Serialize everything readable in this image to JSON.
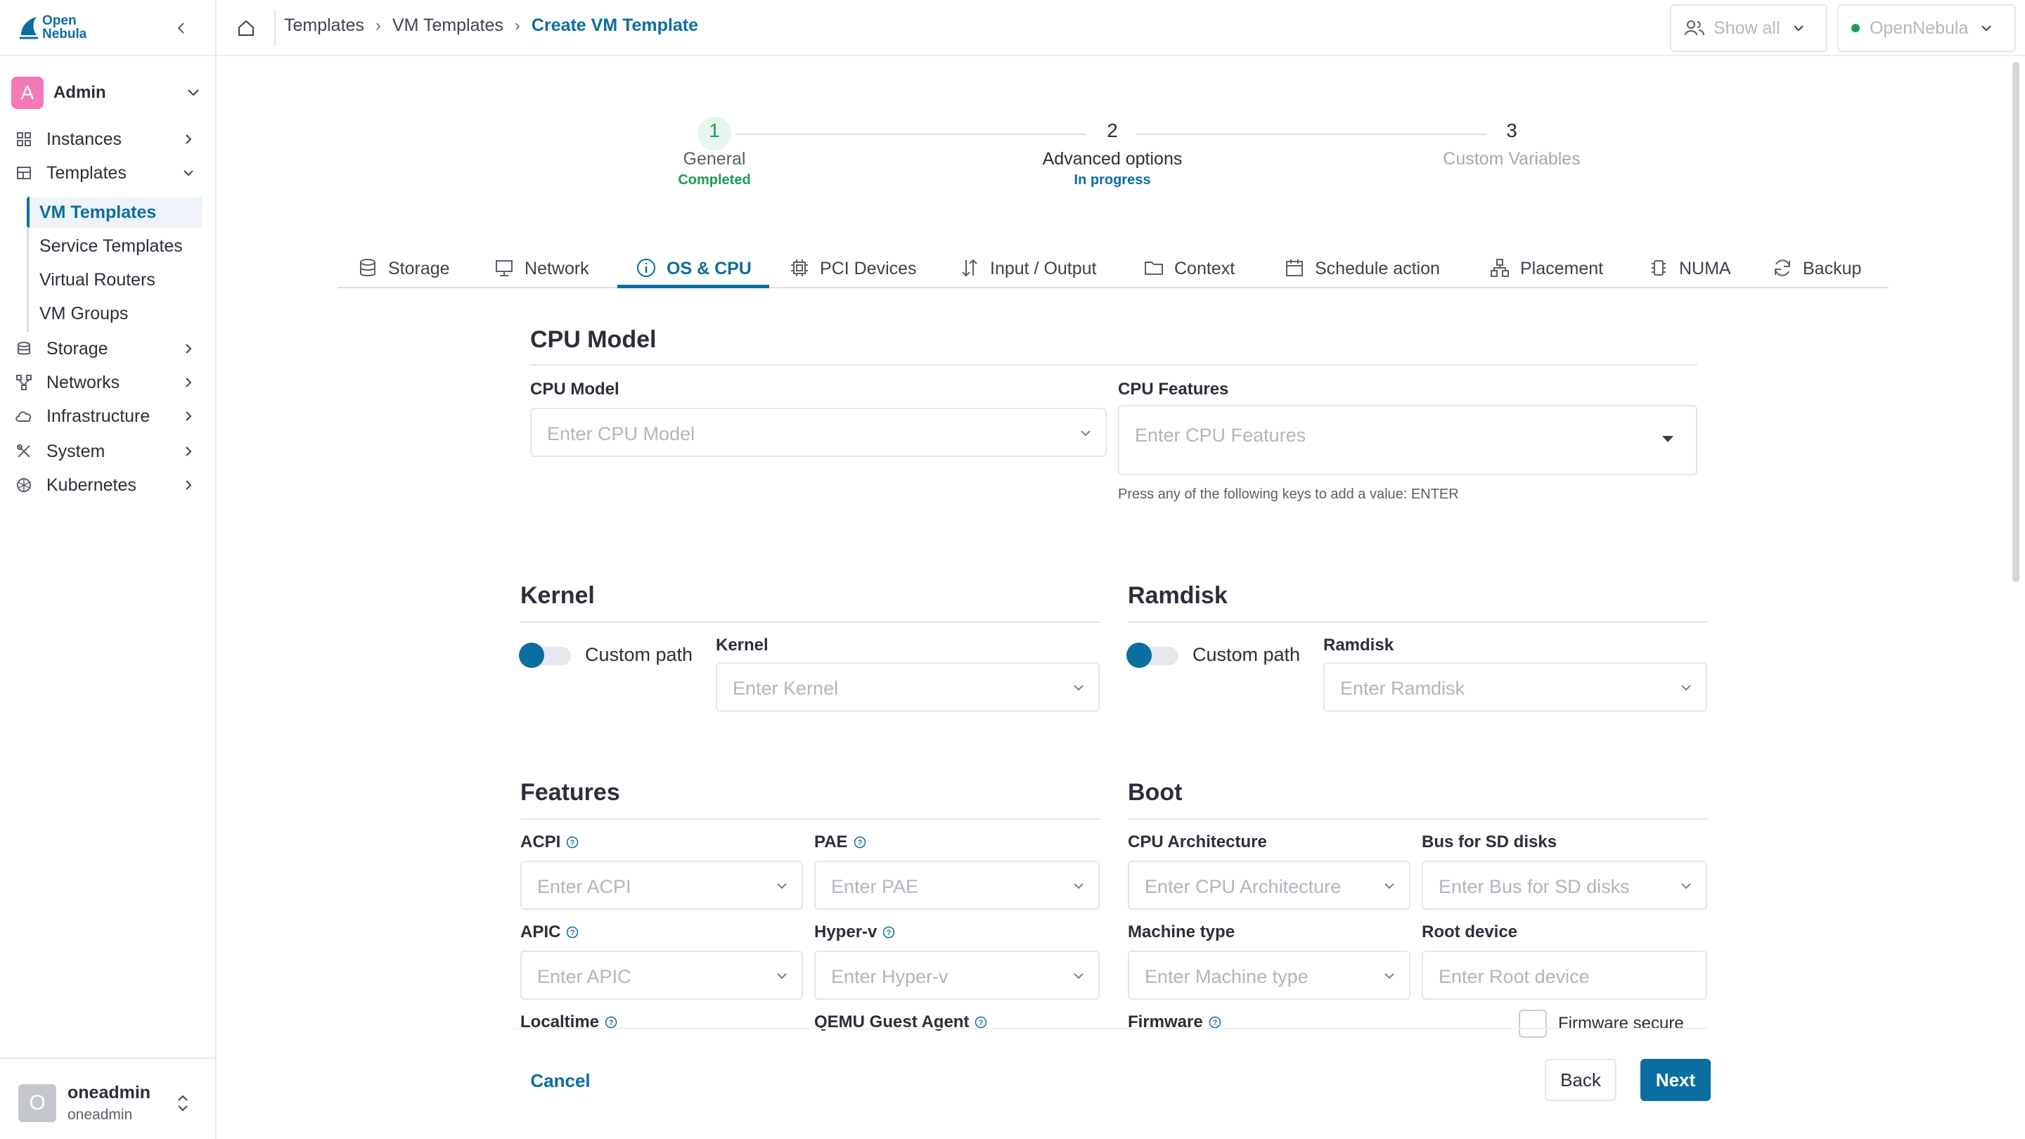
{
  "sidebar": {
    "logo_line1": "Open",
    "logo_line2": "Nebula",
    "account": {
      "initial": "A",
      "name": "Admin"
    },
    "items": [
      {
        "label": "Instances",
        "icon": "grid-icon"
      },
      {
        "label": "Templates",
        "icon": "templates-icon"
      },
      {
        "label": "Storage",
        "icon": "storage-icon"
      },
      {
        "label": "Networks",
        "icon": "network-icon"
      },
      {
        "label": "Infrastructure",
        "icon": "cloud-icon"
      },
      {
        "label": "System",
        "icon": "tools-icon"
      },
      {
        "label": "Kubernetes",
        "icon": "kubernetes-icon"
      }
    ],
    "templates_sub": [
      {
        "label": "VM Templates",
        "active": true
      },
      {
        "label": "Service Templates"
      },
      {
        "label": "Virtual Routers"
      },
      {
        "label": "VM Groups"
      }
    ],
    "user": {
      "initial": "O",
      "name": "oneadmin",
      "sub": "oneadmin"
    }
  },
  "header": {
    "breadcrumb": [
      "Templates",
      "VM Templates",
      "Create VM Template"
    ],
    "group_filter": "Show all",
    "zone_filter": "OpenNebula"
  },
  "stepper": [
    {
      "num": "1",
      "label": "General",
      "status": "Completed"
    },
    {
      "num": "2",
      "label": "Advanced options",
      "status": "In progress"
    },
    {
      "num": "3",
      "label": "Custom Variables",
      "status": ""
    }
  ],
  "tabs": [
    {
      "label": "Storage",
      "icon": "database-icon"
    },
    {
      "label": "Network",
      "icon": "monitor-icon"
    },
    {
      "label": "OS & CPU",
      "icon": "info-icon",
      "active": true
    },
    {
      "label": "PCI Devices",
      "icon": "chip-icon"
    },
    {
      "label": "Input / Output",
      "icon": "arrows-updown-icon"
    },
    {
      "label": "Context",
      "icon": "folder-icon"
    },
    {
      "label": "Schedule action",
      "icon": "calendar-icon"
    },
    {
      "label": "Placement",
      "icon": "placement-icon"
    },
    {
      "label": "NUMA",
      "icon": "numa-chip-icon"
    },
    {
      "label": "Backup",
      "icon": "refresh-icon"
    }
  ],
  "cpu_model": {
    "title": "CPU Model",
    "model_label": "CPU Model",
    "model_placeholder": "Enter CPU Model",
    "features_label": "CPU Features",
    "features_placeholder": "Enter CPU Features",
    "features_hint": "Press any of the following keys to add a value: ENTER"
  },
  "kernel": {
    "title": "Kernel",
    "toggle_label": "Custom path",
    "field_label": "Kernel",
    "placeholder": "Enter Kernel"
  },
  "ramdisk": {
    "title": "Ramdisk",
    "toggle_label": "Custom path",
    "field_label": "Ramdisk",
    "placeholder": "Enter Ramdisk"
  },
  "features": {
    "title": "Features",
    "acpi_label": "ACPI",
    "acpi_placeholder": "Enter ACPI",
    "pae_label": "PAE",
    "pae_placeholder": "Enter PAE",
    "apic_label": "APIC",
    "apic_placeholder": "Enter APIC",
    "hyperv_label": "Hyper-v",
    "hyperv_placeholder": "Enter Hyper-v",
    "localtime_label": "Localtime",
    "qemu_label": "QEMU Guest Agent"
  },
  "boot": {
    "title": "Boot",
    "arch_label": "CPU Architecture",
    "arch_placeholder": "Enter CPU Architecture",
    "bus_label": "Bus for SD disks",
    "bus_placeholder": "Enter Bus for SD disks",
    "machine_label": "Machine type",
    "machine_placeholder": "Enter Machine type",
    "root_label": "Root device",
    "root_placeholder": "Enter Root device",
    "firmware_label": "Firmware",
    "firmware_secure_label": "Firmware secure"
  },
  "footer": {
    "cancel": "Cancel",
    "back": "Back",
    "next": "Next"
  },
  "colors": {
    "accent": "#0b6ea0",
    "success": "#1e9e55",
    "avatar": "#f279b6"
  }
}
